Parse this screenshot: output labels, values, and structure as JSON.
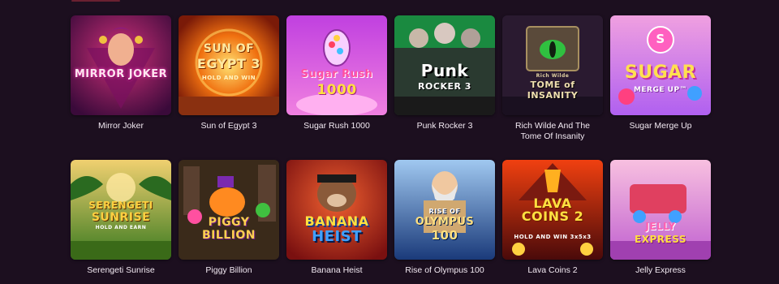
{
  "games": [
    {
      "title": "Mirror Joker",
      "art": "MIRROR JOKER"
    },
    {
      "title": "Sun of Egypt 3",
      "art_line1": "SUN OF",
      "art_line2": "EGYPT 3",
      "art_line3": "HOLD AND WIN"
    },
    {
      "title": "Sugar Rush 1000",
      "art_line1": "Sugar Rush",
      "art_line2": "1000"
    },
    {
      "title": "Punk Rocker 3",
      "art_line1": "Punk",
      "art_line2": "ROCKER 3"
    },
    {
      "title": "Rich Wilde And The Tome Of Insanity",
      "art_line1": "Rich Wilde",
      "art_line2": "TOME of",
      "art_line3": "INSANITY"
    },
    {
      "title": "Sugar Merge Up",
      "art_line1": "SUGAR",
      "art_line2": "MERGE UP™"
    },
    {
      "title": "Serengeti Sunrise",
      "art_line1": "SERENGETI",
      "art_line2": "SUNRISE",
      "art_line3": "HOLD AND EARN"
    },
    {
      "title": "Piggy Billion",
      "art_line1": "PIGGY",
      "art_line2": "BILLION"
    },
    {
      "title": "Banana Heist",
      "art_line1": "BANANA",
      "art_line2": "HEIST"
    },
    {
      "title": "Rise of Olympus 100",
      "art_line1": "RISE OF",
      "art_line2": "OLYMPUS",
      "art_line3": "100"
    },
    {
      "title": "Lava Coins 2",
      "art_line1": "LAVA",
      "art_line2": "COINS 2",
      "art_line3": "HOLD AND WIN 3x5x3"
    },
    {
      "title": "Jelly Express",
      "art_line1": "JELLY",
      "art_line2": "EXPRESS"
    }
  ],
  "colors": {
    "background": "#1c0f1f",
    "title_text": "#f2e9f2"
  }
}
